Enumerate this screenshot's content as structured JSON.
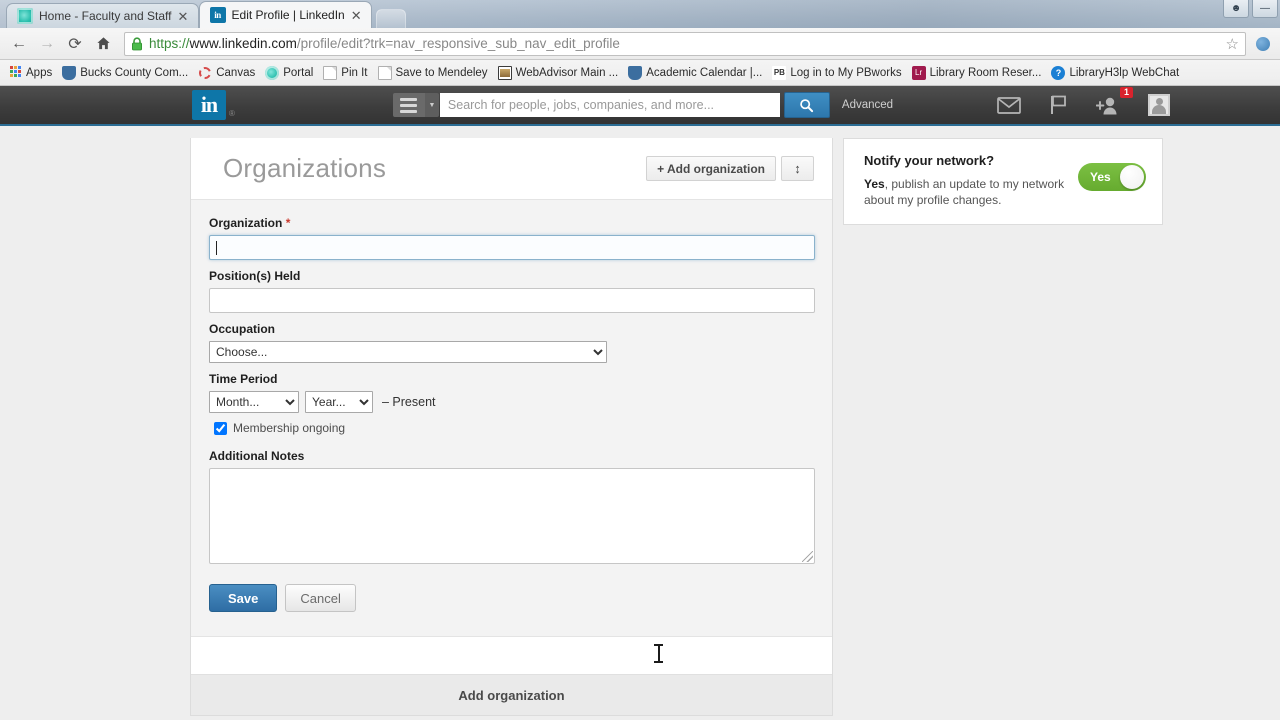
{
  "browser": {
    "tabs": [
      {
        "title": "Home - Faculty and Staff",
        "favicon": "teal-circle-icon",
        "active": false
      },
      {
        "title": "Edit Profile | LinkedIn",
        "favicon": "linkedin-icon",
        "active": true
      }
    ],
    "nav": {
      "back_label": "←",
      "forward_label": "→",
      "reload_label": "⟳",
      "home_label": "⌂"
    },
    "address": {
      "scheme": "https://",
      "host": "www.linkedin.com",
      "path": "/profile/edit?trk=nav_responsive_sub_nav_edit_profile",
      "secure": true
    },
    "bookmarks": [
      {
        "label": "Apps",
        "icon": "apps-grid-icon"
      },
      {
        "label": "Bucks County Com...",
        "icon": "shield-icon"
      },
      {
        "label": "Canvas",
        "icon": "canvas-ring-icon"
      },
      {
        "label": "Portal",
        "icon": "portal-circle-icon"
      },
      {
        "label": "Pin It",
        "icon": "page-icon"
      },
      {
        "label": "Save to Mendeley",
        "icon": "page-icon"
      },
      {
        "label": "WebAdvisor Main ...",
        "icon": "webadvisor-icon"
      },
      {
        "label": "Academic Calendar |...",
        "icon": "shield-icon"
      },
      {
        "label": "Log in to My PBworks",
        "icon": "pbworks-icon"
      },
      {
        "label": "Library Room Reser...",
        "icon": "library-icon"
      },
      {
        "label": "LibraryH3lp WebChat",
        "icon": "help-circle-icon"
      }
    ],
    "window_controls": [
      "user-icon",
      "minimize-icon"
    ]
  },
  "linkedin_nav": {
    "logo_text": "in",
    "registered_mark": "®",
    "search_placeholder": "Search for people, jobs, companies, and more...",
    "search_button_icon": "search-icon",
    "advanced_label": "Advanced",
    "icons": [
      {
        "name": "messages-envelope-icon"
      },
      {
        "name": "notifications-flag-icon"
      },
      {
        "name": "add-connection-icon",
        "badge": "1"
      },
      {
        "name": "profile-avatar-icon"
      }
    ]
  },
  "main": {
    "section_title": "Organizations",
    "add_organization_button": "+ Add organization",
    "reorder_button_icon": "↕",
    "form": {
      "organization": {
        "label": "Organization",
        "required_mark": "*",
        "value": "",
        "focused": true
      },
      "positions_held": {
        "label": "Position(s) Held",
        "value": ""
      },
      "occupation": {
        "label": "Occupation",
        "selected": "Choose...",
        "options": [
          "Choose..."
        ]
      },
      "time_period": {
        "label": "Time Period",
        "month_selected": "Month...",
        "month_options": [
          "Month..."
        ],
        "year_selected": "Year...",
        "year_options": [
          "Year..."
        ],
        "end_text": "– Present",
        "ongoing_label": "Membership ongoing",
        "ongoing_checked": true
      },
      "additional_notes": {
        "label": "Additional Notes",
        "value": ""
      },
      "save_label": "Save",
      "cancel_label": "Cancel"
    },
    "footer_add_label": "Add organization"
  },
  "rail": {
    "notify": {
      "title": "Notify your network?",
      "description_strong": "Yes",
      "description_rest": ", publish an update to my network about my profile changes.",
      "toggle_label": "Yes",
      "toggle_on": true,
      "toggle_color": "#70b63a"
    }
  }
}
